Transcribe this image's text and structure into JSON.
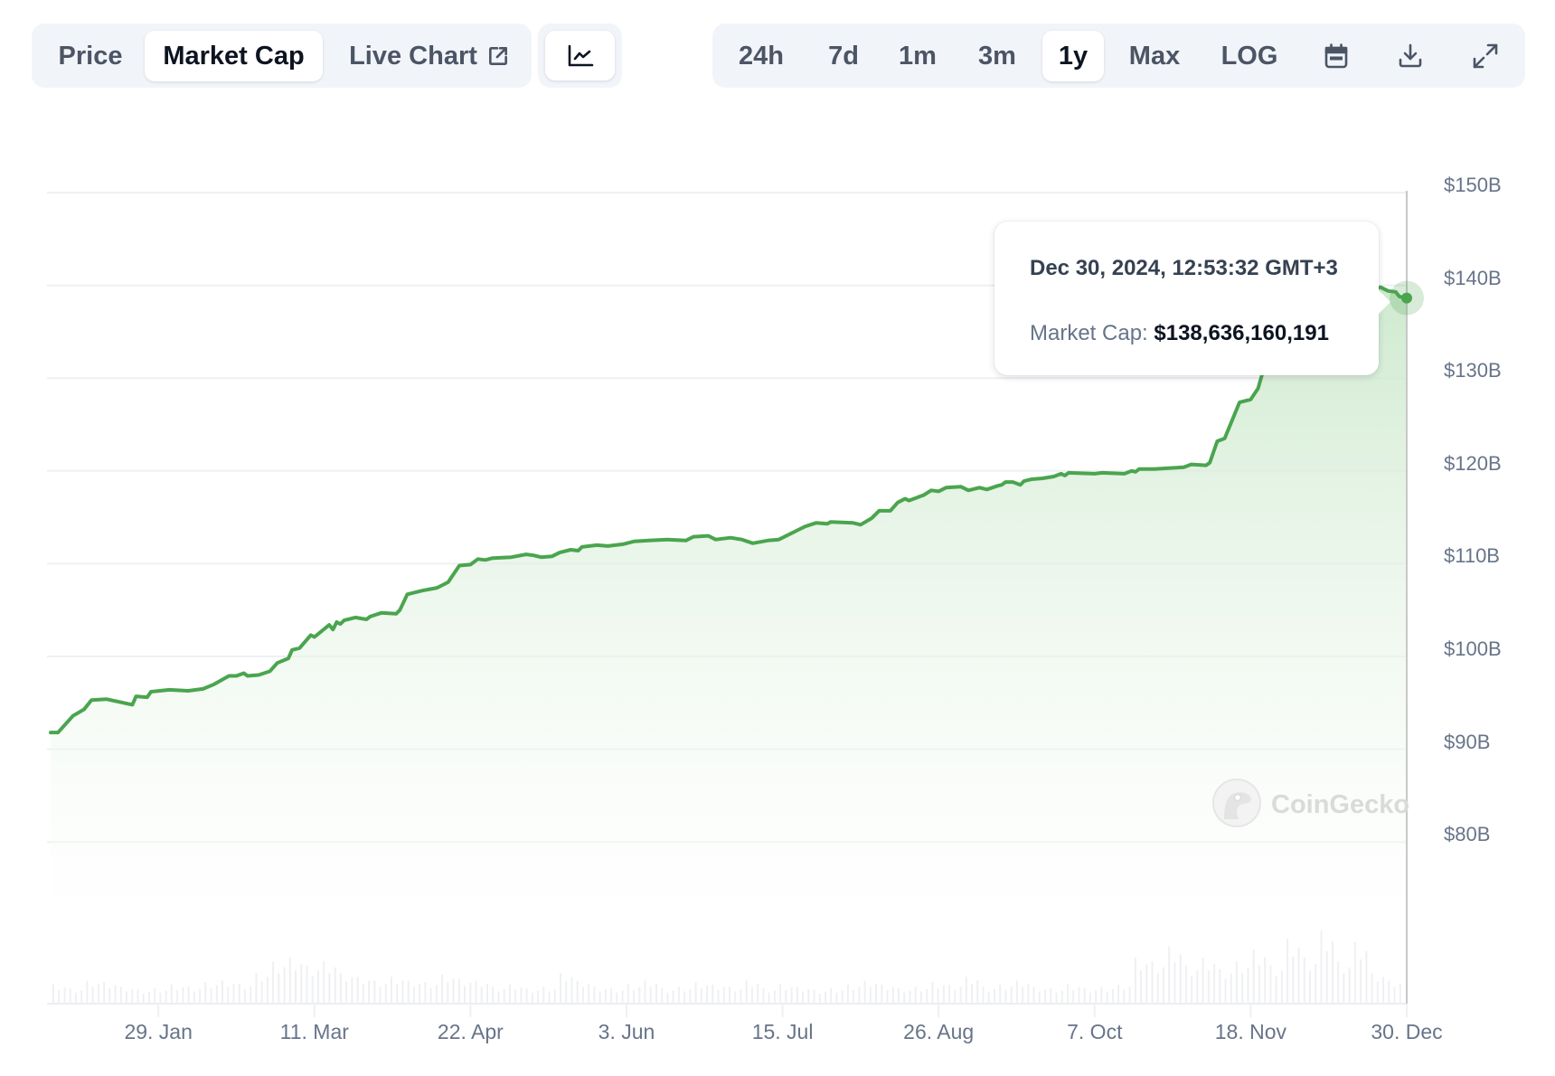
{
  "toolbar": {
    "view_tabs": [
      {
        "label": "Price",
        "active": false
      },
      {
        "label": "Market Cap",
        "active": true
      },
      {
        "label": "Live Chart",
        "active": false,
        "icon": "external-link-icon"
      }
    ],
    "chart_type_button": {
      "icon": "line-chart-icon"
    },
    "ranges": [
      {
        "label": "24h",
        "active": false
      },
      {
        "label": "7d",
        "active": false
      },
      {
        "label": "1m",
        "active": false
      },
      {
        "label": "3m",
        "active": false
      },
      {
        "label": "1y",
        "active": true
      },
      {
        "label": "Max",
        "active": false
      },
      {
        "label": "LOG",
        "active": false
      }
    ],
    "icon_buttons": [
      "calendar-icon",
      "download-icon",
      "fullscreen-icon"
    ]
  },
  "tooltip": {
    "date": "Dec 30, 2024, 12:53:32 GMT+3",
    "label": "Market Cap:",
    "value": "$138,636,160,191"
  },
  "watermark": {
    "text": "CoinGecko"
  },
  "colors": {
    "line": "#4aa54e",
    "area_top": "#c9e7c9",
    "grid": "#eef0f3",
    "volume": "#eff0f3",
    "crosshair": "#c8c8c8"
  },
  "chart_data": {
    "type": "area",
    "title": "",
    "series_name": "Market Cap",
    "xlabel": "",
    "ylabel": "",
    "x_unit": "days since Dec 31, 2023",
    "x_range": [
      0,
      365
    ],
    "ylim": [
      72.5,
      150
    ],
    "y_ticks": [
      150,
      140,
      130,
      120,
      110,
      100,
      90,
      80
    ],
    "y_tick_labels": [
      "$150B",
      "$140B",
      "$130B",
      "$120B",
      "$110B",
      "$100B",
      "$90B",
      "$80B"
    ],
    "x_ticks": [
      {
        "day": 29,
        "label": "29. Jan"
      },
      {
        "day": 71,
        "label": "11. Mar"
      },
      {
        "day": 113,
        "label": "22. Apr"
      },
      {
        "day": 155,
        "label": "3. Jun"
      },
      {
        "day": 197,
        "label": "15. Jul"
      },
      {
        "day": 239,
        "label": "26. Aug"
      },
      {
        "day": 281,
        "label": "7. Oct"
      },
      {
        "day": 323,
        "label": "18. Nov"
      },
      {
        "day": 365,
        "label": "30. Dec"
      }
    ],
    "grid": true,
    "legend": "none",
    "units": "USD billions",
    "points": [
      [
        0,
        91.8
      ],
      [
        2,
        91.8
      ],
      [
        6,
        93.6
      ],
      [
        9,
        94.3
      ],
      [
        11,
        95.3
      ],
      [
        15,
        95.4
      ],
      [
        22,
        94.8
      ],
      [
        23,
        95.7
      ],
      [
        26,
        95.6
      ],
      [
        27,
        96.2
      ],
      [
        32,
        96.4
      ],
      [
        37,
        96.3
      ],
      [
        41,
        96.5
      ],
      [
        44,
        97.0
      ],
      [
        48,
        97.9
      ],
      [
        50,
        97.9
      ],
      [
        52,
        98.2
      ],
      [
        53,
        97.9
      ],
      [
        56,
        98.0
      ],
      [
        59,
        98.4
      ],
      [
        61,
        99.3
      ],
      [
        64,
        99.8
      ],
      [
        65,
        100.7
      ],
      [
        67,
        100.9
      ],
      [
        70,
        102.3
      ],
      [
        71,
        102.1
      ],
      [
        75,
        103.4
      ],
      [
        76,
        102.9
      ],
      [
        77,
        103.7
      ],
      [
        78,
        103.5
      ],
      [
        79,
        103.9
      ],
      [
        82,
        104.2
      ],
      [
        85,
        104.0
      ],
      [
        86,
        104.3
      ],
      [
        89,
        104.7
      ],
      [
        93,
        104.6
      ],
      [
        94,
        105.0
      ],
      [
        96,
        106.7
      ],
      [
        100,
        107.1
      ],
      [
        104,
        107.4
      ],
      [
        107,
        108.0
      ],
      [
        108,
        108.6
      ],
      [
        110,
        109.8
      ],
      [
        113,
        109.9
      ],
      [
        115,
        110.5
      ],
      [
        117,
        110.4
      ],
      [
        119,
        110.6
      ],
      [
        124,
        110.7
      ],
      [
        128,
        111.0
      ],
      [
        130,
        110.9
      ],
      [
        132,
        110.7
      ],
      [
        135,
        110.8
      ],
      [
        137,
        111.2
      ],
      [
        140,
        111.5
      ],
      [
        142,
        111.4
      ],
      [
        143,
        111.8
      ],
      [
        147,
        112.0
      ],
      [
        150,
        111.9
      ],
      [
        154,
        112.1
      ],
      [
        157,
        112.4
      ],
      [
        161,
        112.5
      ],
      [
        166,
        112.6
      ],
      [
        171,
        112.5
      ],
      [
        173,
        112.9
      ],
      [
        177,
        113.0
      ],
      [
        179,
        112.6
      ],
      [
        183,
        112.8
      ],
      [
        186,
        112.6
      ],
      [
        189,
        112.2
      ],
      [
        193,
        112.5
      ],
      [
        196,
        112.6
      ],
      [
        199,
        113.2
      ],
      [
        201,
        113.6
      ],
      [
        203,
        114.0
      ],
      [
        206,
        114.4
      ],
      [
        209,
        114.3
      ],
      [
        210,
        114.5
      ],
      [
        216,
        114.4
      ],
      [
        218,
        114.2
      ],
      [
        221,
        114.9
      ],
      [
        223,
        115.7
      ],
      [
        226,
        115.7
      ],
      [
        228,
        116.6
      ],
      [
        230,
        117.0
      ],
      [
        231,
        116.8
      ],
      [
        233,
        117.1
      ],
      [
        235,
        117.4
      ],
      [
        237,
        117.9
      ],
      [
        239,
        117.8
      ],
      [
        241,
        118.2
      ],
      [
        245,
        118.3
      ],
      [
        247,
        117.9
      ],
      [
        250,
        118.2
      ],
      [
        252,
        118.0
      ],
      [
        255,
        118.4
      ],
      [
        256,
        118.5
      ],
      [
        257,
        118.8
      ],
      [
        259,
        118.8
      ],
      [
        261,
        118.5
      ],
      [
        262,
        118.9
      ],
      [
        264,
        119.1
      ],
      [
        267,
        119.2
      ],
      [
        270,
        119.4
      ],
      [
        272,
        119.7
      ],
      [
        273,
        119.5
      ],
      [
        274,
        119.8
      ],
      [
        281,
        119.7
      ],
      [
        283,
        119.8
      ],
      [
        289,
        119.7
      ],
      [
        291,
        120.0
      ],
      [
        292,
        119.9
      ],
      [
        293,
        120.2
      ],
      [
        297,
        120.2
      ],
      [
        301,
        120.3
      ],
      [
        305,
        120.4
      ],
      [
        307,
        120.7
      ],
      [
        311,
        120.6
      ],
      [
        312,
        120.9
      ],
      [
        314,
        123.2
      ],
      [
        316,
        123.5
      ],
      [
        320,
        127.4
      ],
      [
        323,
        127.7
      ],
      [
        325,
        128.9
      ],
      [
        326,
        130.3
      ],
      [
        329,
        132.7
      ],
      [
        332,
        134.7
      ],
      [
        337,
        137.1
      ],
      [
        344,
        138.6
      ],
      [
        351,
        139.4
      ],
      [
        358,
        139.8
      ],
      [
        360,
        139.4
      ],
      [
        362,
        139.3
      ],
      [
        363,
        138.8
      ],
      [
        365,
        138.636
      ]
    ],
    "volume_relative": [
      0.25,
      0.2,
      0.3,
      0.28,
      0.22,
      0.18,
      0.2,
      0.25,
      0.22,
      0.28,
      0.3,
      0.26,
      0.4,
      0.55,
      0.6,
      0.5,
      0.55,
      0.4,
      0.35,
      0.3,
      0.35,
      0.3,
      0.28,
      0.38,
      0.32,
      0.3,
      0.22,
      0.25,
      0.2,
      0.22,
      0.4,
      0.3,
      0.22,
      0.2,
      0.25,
      0.3,
      0.2,
      0.22,
      0.28,
      0.25,
      0.22,
      0.3,
      0.2,
      0.25,
      0.22,
      0.18,
      0.2,
      0.25,
      0.3,
      0.25,
      0.2,
      0.22,
      0.28,
      0.25,
      0.35,
      0.22,
      0.25,
      0.3,
      0.22,
      0.2,
      0.25,
      0.2,
      0.22,
      0.25,
      0.6,
      0.55,
      0.75,
      0.5,
      0.6,
      0.45,
      0.55,
      0.7,
      0.5,
      0.85,
      0.6,
      0.95,
      0.55,
      0.8,
      0.4,
      0.3
    ],
    "hover": {
      "day": 365,
      "value": 138.636
    }
  }
}
